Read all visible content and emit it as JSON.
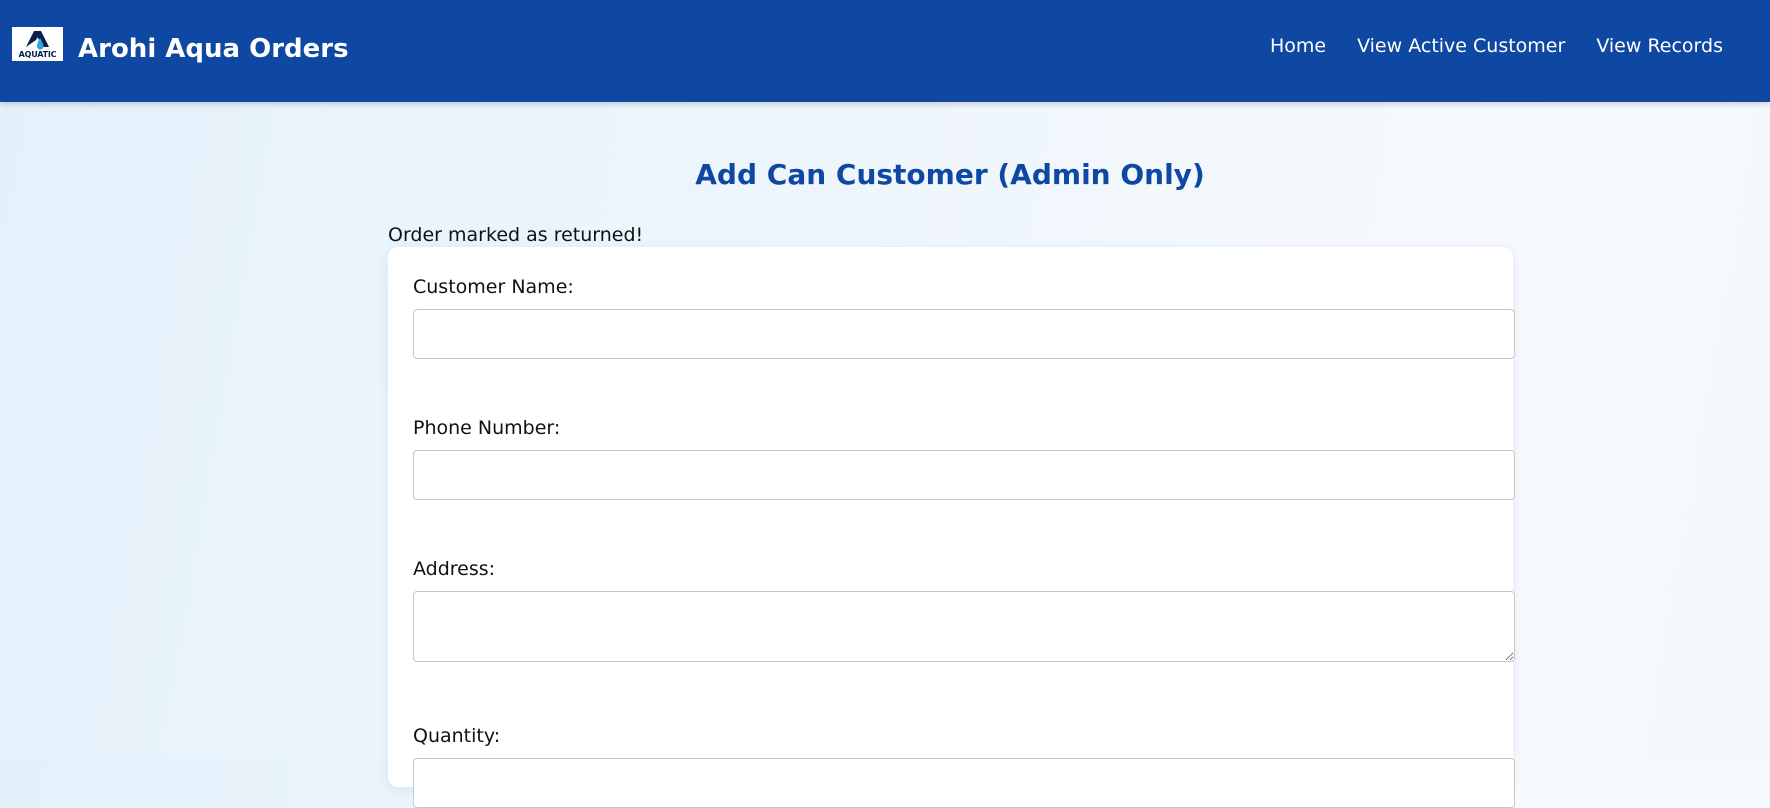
{
  "header": {
    "logo_text": "AQUATIC",
    "brand": "Arohi Aqua Orders",
    "nav": [
      {
        "label": "Home"
      },
      {
        "label": "View Active Customer"
      },
      {
        "label": "View Records"
      }
    ],
    "colors": {
      "nav_background": "#0f48a2",
      "nav_text": "#ffffff"
    }
  },
  "main": {
    "title": "Add Can Customer (Admin Only)",
    "flash_message": "Order marked as returned!",
    "form": {
      "fields": [
        {
          "label": "Customer Name:",
          "value": "",
          "type": "text"
        },
        {
          "label": "Phone Number:",
          "value": "",
          "type": "text"
        },
        {
          "label": "Address:",
          "value": "",
          "type": "textarea"
        },
        {
          "label": "Quantity:",
          "value": "",
          "type": "number"
        }
      ]
    },
    "colors": {
      "title": "#0f48a2",
      "card_background": "#ffffff"
    }
  }
}
